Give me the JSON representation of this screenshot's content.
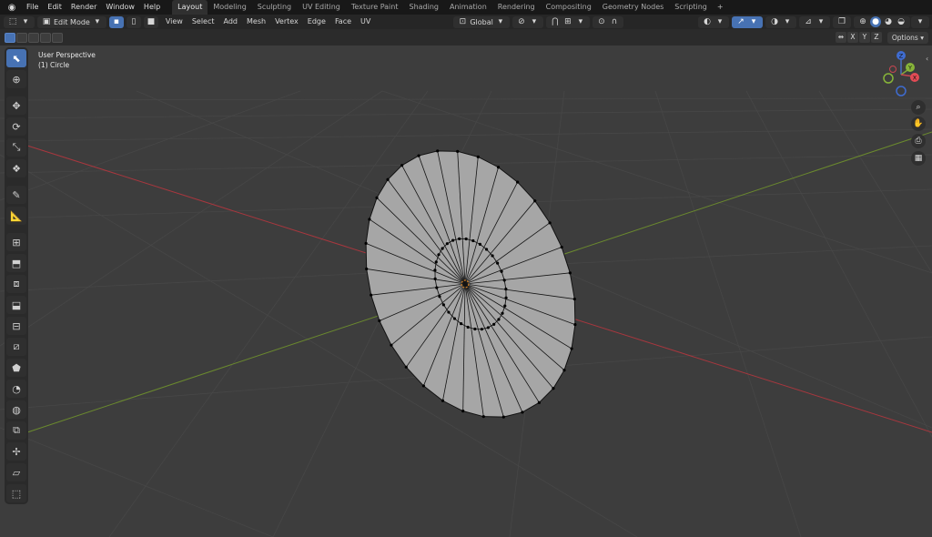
{
  "menu": {
    "items": [
      "File",
      "Edit",
      "Render",
      "Window",
      "Help"
    ]
  },
  "workspaces": {
    "tabs": [
      "Layout",
      "Modeling",
      "Sculpting",
      "UV Editing",
      "Texture Paint",
      "Shading",
      "Animation",
      "Rendering",
      "Compositing",
      "Geometry Nodes",
      "Scripting"
    ],
    "active": "Layout",
    "add": "+"
  },
  "header": {
    "mode": "Edit Mode",
    "menus": [
      "View",
      "Select",
      "Add",
      "Mesh",
      "Vertex",
      "Edge",
      "Face",
      "UV"
    ],
    "orientation": "Global"
  },
  "subheader": {
    "axes": [
      "X",
      "Y",
      "Z"
    ],
    "options": "Options"
  },
  "viewport": {
    "view_name": "User Perspective",
    "object_name": "(1) Circle"
  },
  "gizmo": {
    "z": "Z",
    "y": "Y",
    "x": "X"
  },
  "colors": {
    "x_axis": "#a8373e",
    "y_axis": "#6b8a2e",
    "select": "#4772b3",
    "mesh_face": "#a6a6a6"
  }
}
